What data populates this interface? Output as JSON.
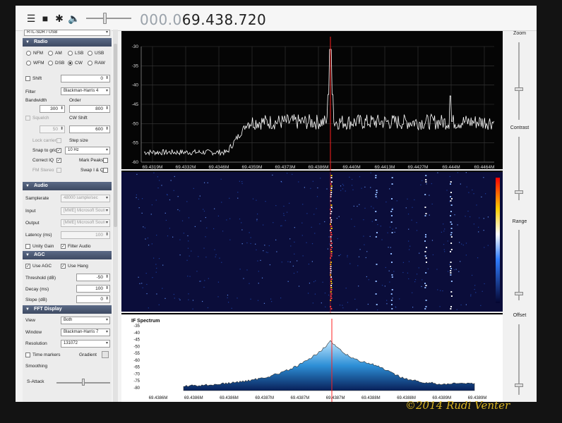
{
  "toolbar": {
    "icons": [
      "menu-icon",
      "stop-icon",
      "gear-icon",
      "speaker-icon"
    ],
    "frequency_dim": "000.0",
    "frequency_main": "69.438.720",
    "volume": 0.4
  },
  "sidebar": {
    "device_select": "RTL-SDR / USB",
    "radio": {
      "title": "Radio",
      "modes": [
        {
          "label": "NFM",
          "selected": false
        },
        {
          "label": "AM",
          "selected": false
        },
        {
          "label": "LSB",
          "selected": false
        },
        {
          "label": "USB",
          "selected": false
        },
        {
          "label": "WFM",
          "selected": false
        },
        {
          "label": "DSB",
          "selected": false
        },
        {
          "label": "CW",
          "selected": true
        },
        {
          "label": "RAW",
          "selected": false
        }
      ],
      "shift_label": "Shift",
      "shift_value": "0",
      "filter_label": "Filter",
      "filter_value": "Blackman-Harris 4",
      "bandwidth_label": "Bandwidth",
      "bandwidth_value": "300",
      "order_label": "Order",
      "order_value": "800",
      "squelch_label": "Squelch",
      "squelch_value": "50",
      "cw_shift_label": "CW Shift",
      "cw_shift_value": "600",
      "lock_carrier_label": "Lock carrier",
      "step_size_label": "Step size",
      "snap_label": "Snap to grid",
      "snap_value": "10 Hz",
      "correct_iq_label": "Correct IQ",
      "mark_peaks_label": "Mark Peaks",
      "fm_stereo_label": "FM Stereo",
      "swap_iq_label": "Swap I & Q"
    },
    "audio": {
      "title": "Audio",
      "samplerate_label": "Samplerate",
      "samplerate_value": "48000 sample/sec",
      "input_label": "Input",
      "input_value": "[MME] Microsoft Soun",
      "output_label": "Output",
      "output_value": "[MME] Microsoft Soun",
      "latency_label": "Latency (ms)",
      "latency_value": "100",
      "unity_gain_label": "Unity Gain",
      "filter_audio_label": "Filter Audio"
    },
    "agc": {
      "title": "AGC",
      "use_agc_label": "Use AGC",
      "use_hang_label": "Use Hang",
      "threshold_label": "Threshold (dB)",
      "threshold_value": "-50",
      "decay_label": "Decay (ms)",
      "decay_value": "100",
      "slope_label": "Slope (dB)",
      "slope_value": "0"
    },
    "fft": {
      "title": "FFT Display",
      "view_label": "View",
      "view_value": "Both",
      "window_label": "Window",
      "window_value": "Blackman-Harris 7",
      "resolution_label": "Resolution",
      "resolution_value": "131072",
      "time_markers_label": "Time markers",
      "gradient_label": "Gradient",
      "smoothing_label": "Smoothing",
      "s_attack_label": "S-Attack"
    }
  },
  "spectrum": {
    "y_ticks": [
      "-30",
      "-35",
      "-40",
      "-45",
      "-50",
      "-55",
      "-60"
    ],
    "x_ticks": [
      "69.4319M",
      "69.4332M",
      "69.4346M",
      "69.4359M",
      "69.4373M",
      "69.4386M",
      "69.440M",
      "69.4413M",
      "69.4427M",
      "69.444M",
      "69.4464M"
    ]
  },
  "if_spectrum": {
    "title": "IF Spectrum",
    "y_ticks": [
      "-35",
      "-40",
      "-45",
      "-50",
      "-55",
      "-60",
      "-65",
      "-70",
      "-75",
      "-80"
    ],
    "x_ticks": [
      "69.4386M",
      "69.4386M",
      "69.4386M",
      "69.4387M",
      "69.4387M",
      "69.4387M",
      "69.4388M",
      "69.4388M",
      "69.4389M",
      "69.4389M"
    ]
  },
  "rightbar": {
    "zoom_label": "Zoom",
    "contrast_label": "Contrast",
    "range_label": "Range",
    "offset_label": "Offset"
  },
  "watermark": "©2014 Rudi Venter",
  "colors": {
    "trace": "#ffffff",
    "marker": "#ff2020",
    "section_header": "#4a5773",
    "waterfall_bg": "#0b0d3a",
    "if_fill": "#2d8fd6"
  }
}
